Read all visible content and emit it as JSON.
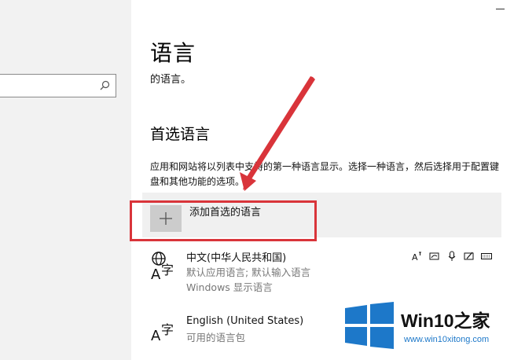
{
  "page": {
    "title": "语言",
    "description": "的语言。"
  },
  "preferred": {
    "title": "首选语言",
    "description": "应用和网站将以列表中支持的第一种语言显示。选择一种语言，然后选择用于配置键盘和其他功能的选项。",
    "add_label": "添加首选的语言"
  },
  "languages": [
    {
      "name": "中文(中华人民共和国)",
      "details": [
        "默认应用语言; 默认输入语言",
        "Windows 显示语言"
      ],
      "features": [
        "text-to-speech-icon",
        "handwriting-icon",
        "microphone-icon",
        "pen-icon",
        "keyboard-icon"
      ]
    },
    {
      "name": "English (United States)",
      "details": [
        "可用的语言包"
      ]
    }
  ],
  "watermark": {
    "title": "Win10之家",
    "url": "www.win10xitong.com"
  },
  "colors": {
    "left_pane": "#f2f2f2",
    "highlight": "#d9343a",
    "watermark_blue": "#1d78c9"
  }
}
